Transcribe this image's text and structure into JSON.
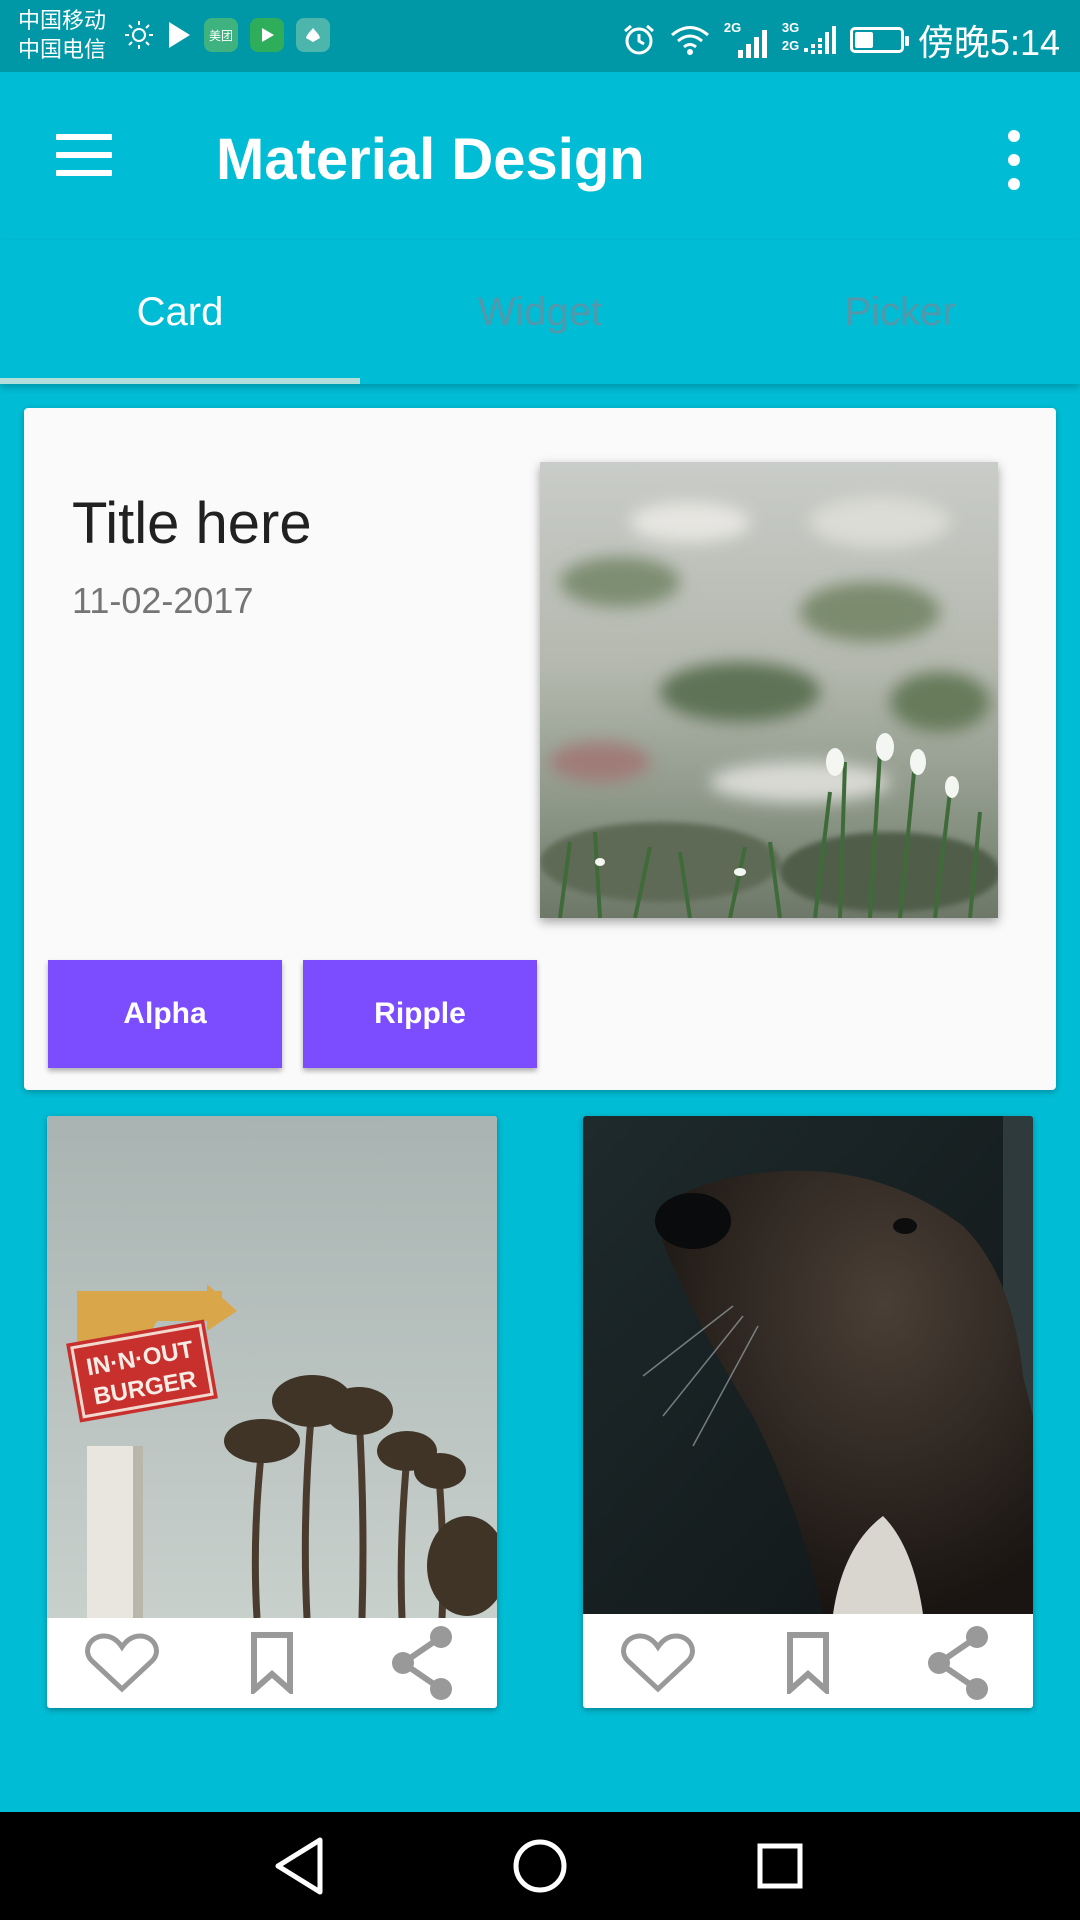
{
  "status_bar": {
    "carrier_1": "中国移动",
    "carrier_2": "中国电信",
    "time": "傍晚5:14",
    "signal_1": "2G",
    "signal_2_top": "3G",
    "signal_2_bottom": "2G",
    "battery_level": 0.4,
    "app_icons": [
      "brightness-icon",
      "play-icon",
      "meituan-app-icon",
      "video-app-icon",
      "huawei-app-icon"
    ]
  },
  "app_bar": {
    "title": "Material Design",
    "menu_icon": "hamburger-menu-icon",
    "more_icon": "more-vert-icon"
  },
  "tabs": [
    {
      "label": "Card",
      "active": true
    },
    {
      "label": "Widget",
      "active": false
    },
    {
      "label": "Picker",
      "active": false
    }
  ],
  "card": {
    "title": "Title here",
    "date": "11-02-2017",
    "buttons": [
      "Alpha",
      "Ripple"
    ]
  },
  "small_cards": [
    {
      "photo": "in-n-out-burger-sign-with-palm-trees",
      "sign_line_1": "IN·N·OUT",
      "sign_line_2": "BURGER",
      "actions": [
        "favorite-icon",
        "bookmark-icon",
        "share-icon"
      ]
    },
    {
      "photo": "dog-profile-in-dark",
      "actions": [
        "favorite-icon",
        "bookmark-icon",
        "share-icon"
      ]
    }
  ],
  "nav_bar": [
    "back-icon",
    "home-icon",
    "recents-icon"
  ],
  "colors": {
    "primary": "#00BCD4",
    "primary_dark": "#0097A7",
    "accent": "#7C4DFF",
    "indicator": "#B2DFDB"
  }
}
